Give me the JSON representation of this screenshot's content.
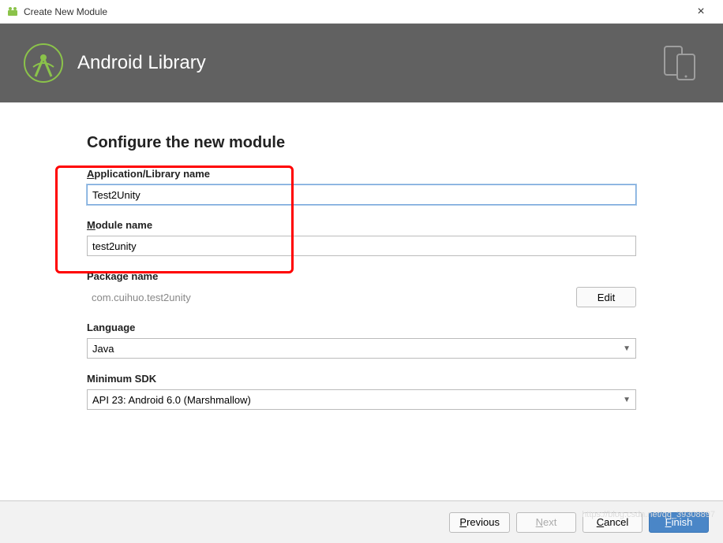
{
  "window": {
    "title": "Create New Module",
    "close": "×"
  },
  "header": {
    "title": "Android Library"
  },
  "section": {
    "title": "Configure the new module"
  },
  "fields": {
    "app_name": {
      "label_prefix": "A",
      "label_rest": "pplication/Library name",
      "value": "Test2Unity"
    },
    "module_name": {
      "label_prefix": "M",
      "label_rest": "odule name",
      "value": "test2unity"
    },
    "package_name": {
      "label": "Package name",
      "value": "com.cuihuo.test2unity",
      "edit": "Edit"
    },
    "language": {
      "label": "Language",
      "value": "Java"
    },
    "min_sdk": {
      "label": "Minimum SDK",
      "value": "API 23: Android 6.0 (Marshmallow)"
    }
  },
  "footer": {
    "previous_u": "P",
    "previous_rest": "revious",
    "next_u": "N",
    "next_rest": "ext",
    "cancel_pre": "",
    "cancel_u": "C",
    "cancel_rest": "ancel",
    "finish_u": "F",
    "finish_rest": "inish"
  },
  "watermark": "https://blog.csdn.net/qq_39308897"
}
